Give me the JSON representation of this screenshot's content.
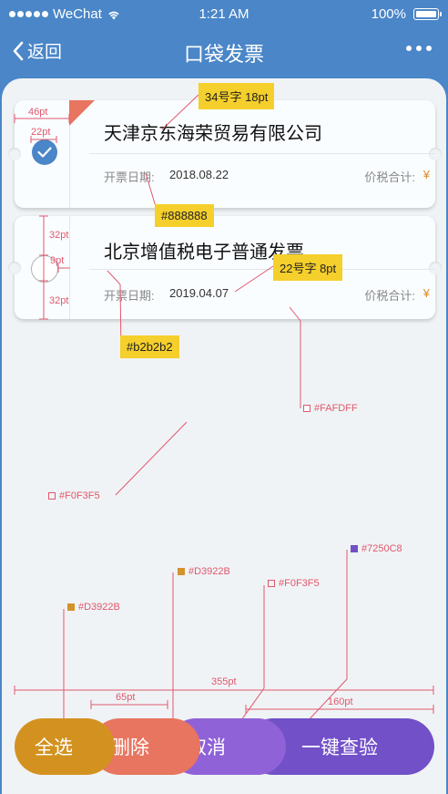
{
  "status_bar": {
    "carrier": "WeChat",
    "time": "1:21 AM",
    "battery": "100%"
  },
  "nav": {
    "back_label": "返回",
    "title": "口袋发票"
  },
  "invoices": [
    {
      "company": "天津京东海荣贸易有限公司",
      "date_label": "开票日期:",
      "date": "2018.08.22",
      "price_label": "价税合计:",
      "currency": "¥",
      "selected": true
    },
    {
      "company": "北京增值税电子普通发票",
      "date_label": "开票日期:",
      "date": "2019.04.07",
      "price_label": "价税合计:",
      "currency": "¥",
      "selected": false
    }
  ],
  "annotations": {
    "font_title": "34号字  18pt",
    "font_body": "22号字  8pt",
    "color_text_title": "#888888",
    "color_radio": "#b2b2b2",
    "color_card": "#FAFDFF",
    "color_bg": "#F0F3F5",
    "dim_corner": "46pt",
    "dim_check": "22pt",
    "dim_top": "32pt",
    "dim_mid": "9pt",
    "dim_bottom": "32pt",
    "btn_color_select_all": "#D3922B",
    "btn_color_delete": "#D3922B",
    "btn_color_cancel": "#F0F3F5",
    "btn_color_verify": "#7250C8",
    "dim_total": "355pt",
    "dim_delete": "65pt",
    "dim_verify": "160pt"
  },
  "buttons": {
    "select_all": "全选",
    "delete": "删除",
    "cancel": "取消",
    "verify": "一键查验"
  },
  "colors": {
    "primary": "#4a86c8",
    "bg": "#f0f3f5",
    "card": "#fafdff",
    "orange": "#d39220",
    "red": "#e87560",
    "purple": "#7250c8",
    "annotation": "#e0586e",
    "tag": "#f5cf2b"
  }
}
